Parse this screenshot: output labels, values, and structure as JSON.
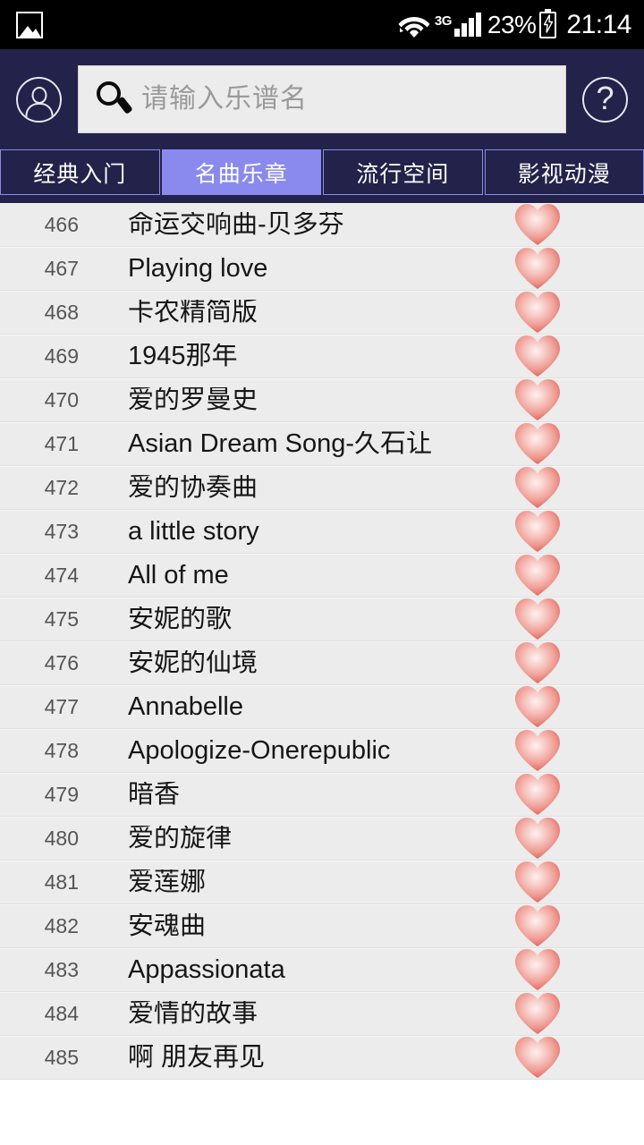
{
  "status_bar": {
    "photo_icon": "photo-icon",
    "wifi_icon": "wifi-icon",
    "network_type": "3G",
    "signal_icon": "signal-bars-icon",
    "battery_percent": "23%",
    "battery_icon": "battery-charging-icon",
    "charging_bolt": "⚡",
    "time": "21:14"
  },
  "header": {
    "profile_icon": "user-avatar-icon",
    "help_icon": "help-question-icon",
    "help_glyph": "?",
    "search": {
      "icon": "search-magnifier-icon",
      "value": "",
      "placeholder": "请输入乐谱名"
    }
  },
  "tabs": [
    {
      "label": "经典入门",
      "active": false
    },
    {
      "label": "名曲乐章",
      "active": true
    },
    {
      "label": "流行空间",
      "active": false
    },
    {
      "label": "影视动漫",
      "active": false
    }
  ],
  "colors": {
    "header_navy": "#23224a",
    "tab_active": "#8a8aee",
    "tab_border": "#8a8ae8",
    "row_bg": "#ececec",
    "heart_pink": "#ee8d8d",
    "status_bar_bg": "#000000"
  },
  "list": {
    "favorite_icon": "heart-favorite-icon",
    "rows": [
      {
        "index": "466",
        "title": "命运交响曲-贝多芬"
      },
      {
        "index": "467",
        "title": "Playing love"
      },
      {
        "index": "468",
        "title": "卡农精简版"
      },
      {
        "index": "469",
        "title": "1945那年"
      },
      {
        "index": "470",
        "title": "爱的罗曼史"
      },
      {
        "index": "471",
        "title": "Asian Dream Song-久石让"
      },
      {
        "index": "472",
        "title": "爱的协奏曲"
      },
      {
        "index": "473",
        "title": "a little story"
      },
      {
        "index": "474",
        "title": "All of me"
      },
      {
        "index": "475",
        "title": "安妮的歌"
      },
      {
        "index": "476",
        "title": "安妮的仙境"
      },
      {
        "index": "477",
        "title": "Annabelle"
      },
      {
        "index": "478",
        "title": "Apologize-Onerepublic"
      },
      {
        "index": "479",
        "title": "暗香"
      },
      {
        "index": "480",
        "title": "爱的旋律"
      },
      {
        "index": "481",
        "title": "爱莲娜"
      },
      {
        "index": "482",
        "title": "安魂曲"
      },
      {
        "index": "483",
        "title": "Appassionata"
      },
      {
        "index": "484",
        "title": "爱情的故事"
      },
      {
        "index": "485",
        "title": "啊 朋友再见"
      }
    ]
  }
}
